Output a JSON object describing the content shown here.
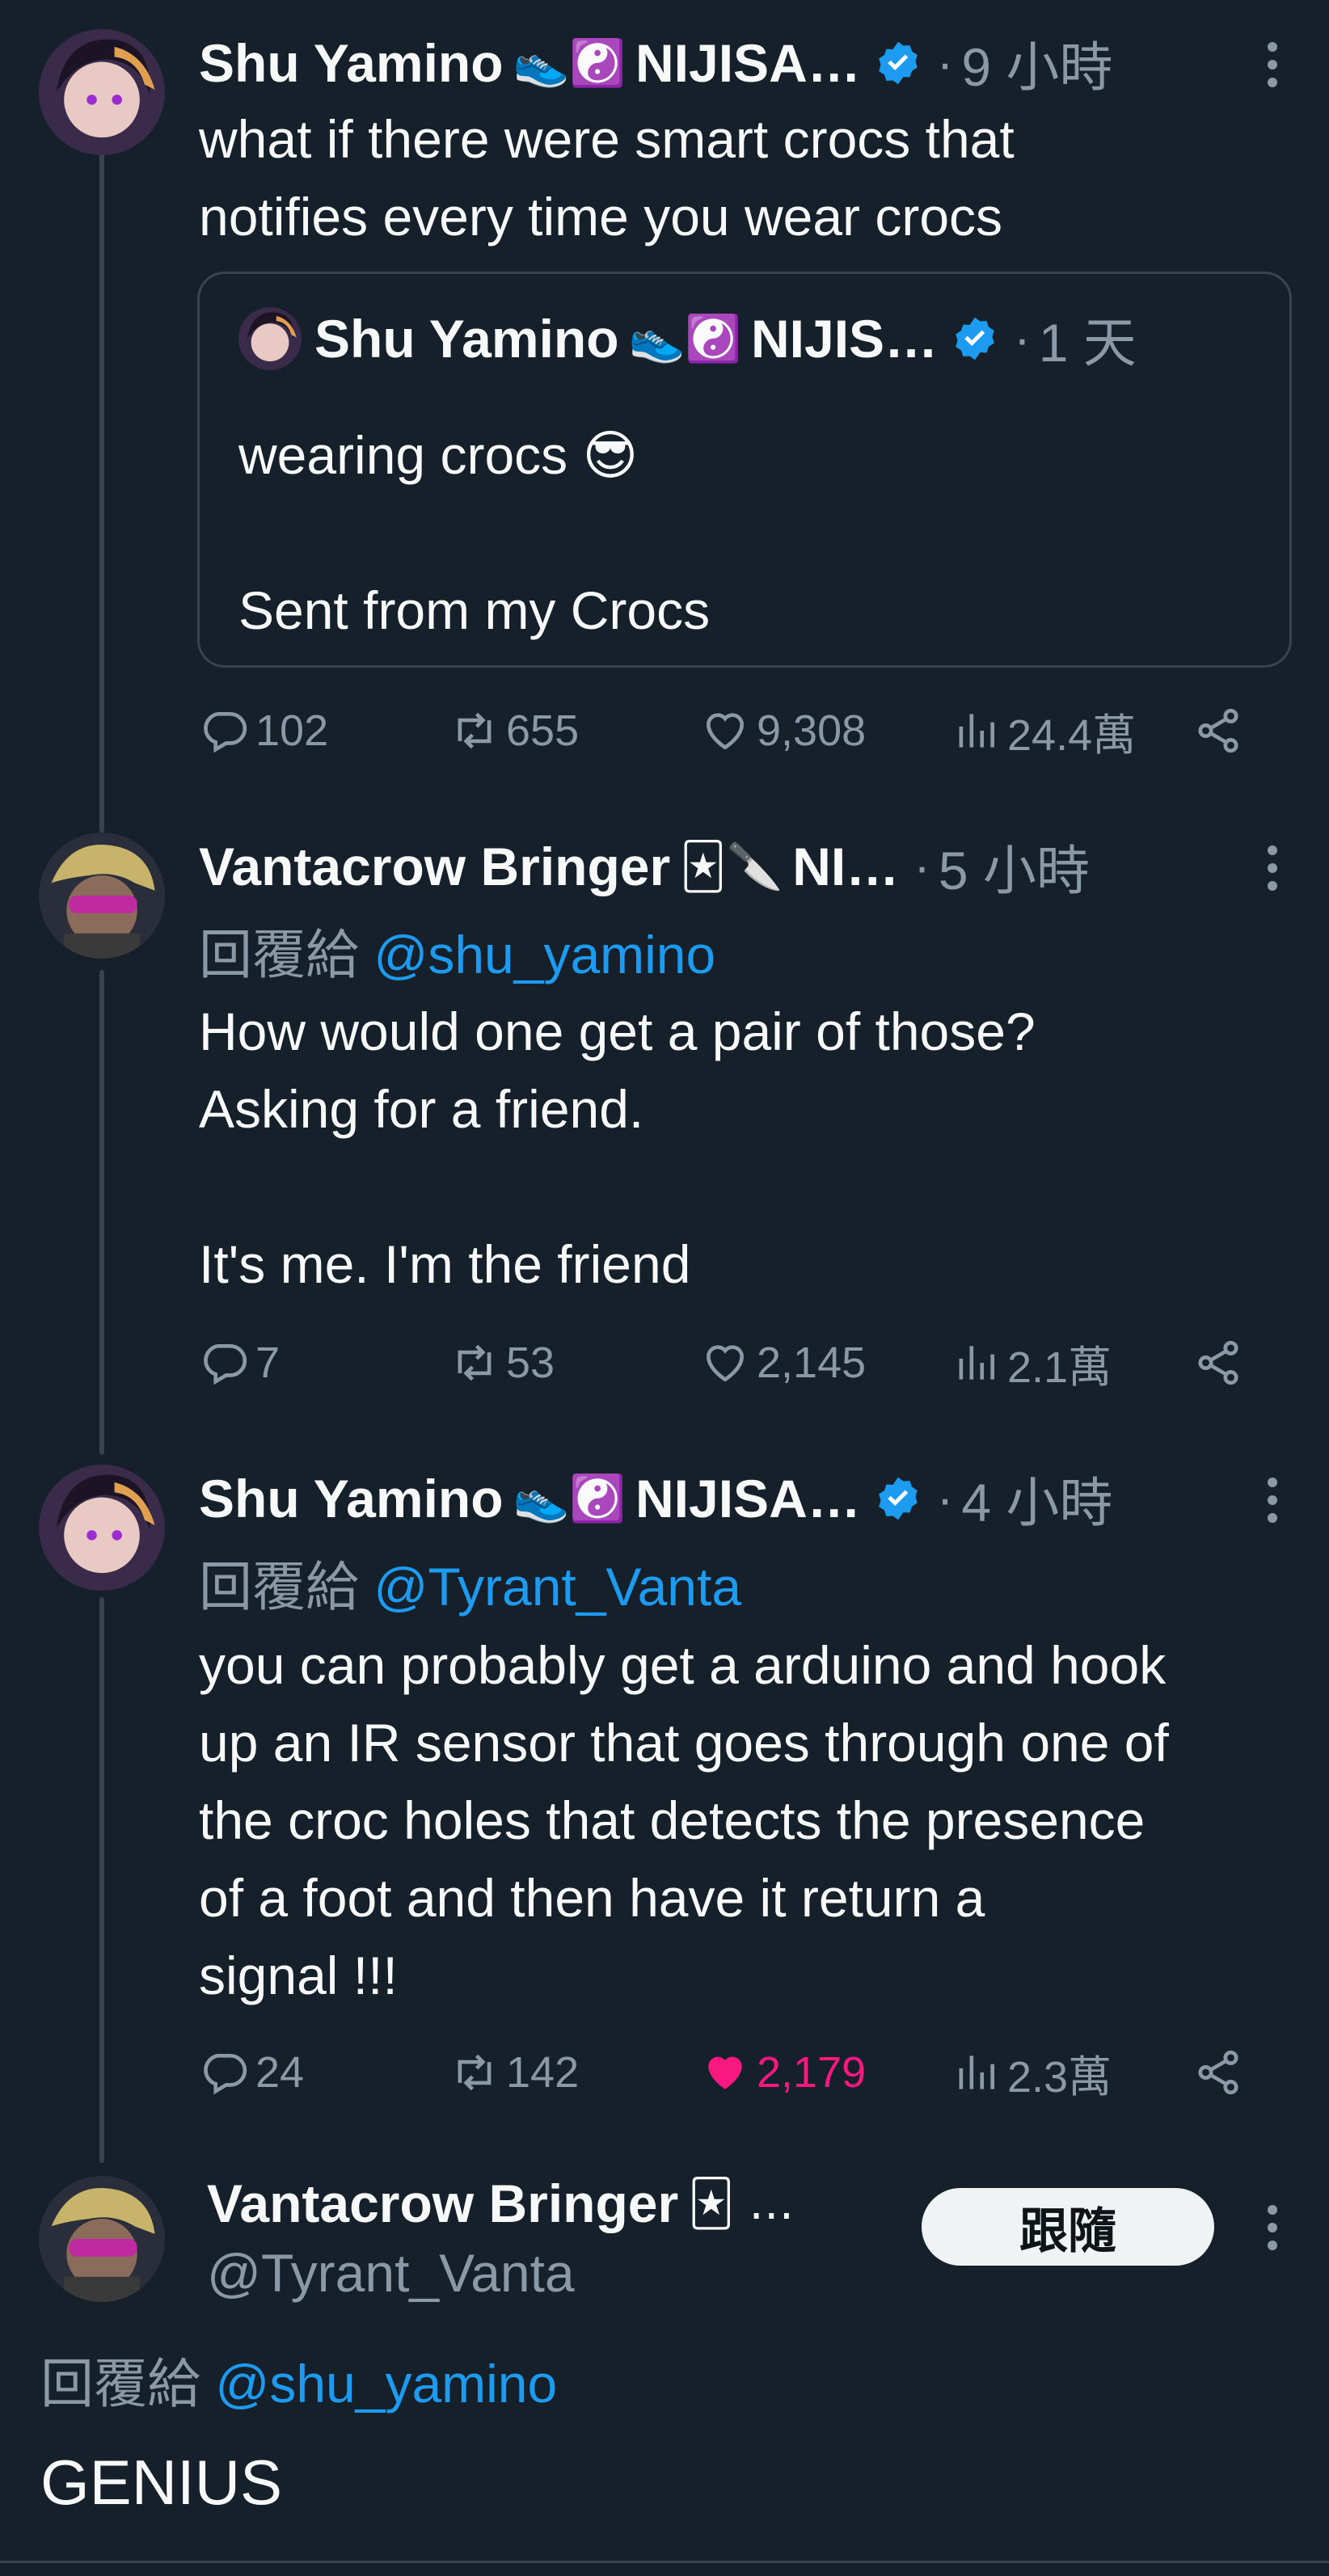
{
  "tweets": [
    {
      "name": "Shu Yamino",
      "emojis": "👟☯️",
      "org": "NIJISA…",
      "verified": true,
      "time": "9 小時",
      "text": "what if there were smart crocs that\nnotifies every time you wear crocs",
      "quote": {
        "name": "Shu Yamino",
        "emojis": "👟☯️",
        "org": "NIJIS…",
        "time": "1 天",
        "text": "wearing crocs 😎\n\nSent from my Crocs"
      },
      "actions": {
        "replies": "102",
        "retweets": "655",
        "likes": "9,308",
        "views": "24.4萬"
      }
    },
    {
      "name": "Vantacrow Bringer",
      "emojis": "🃏🔪",
      "org": "NI…",
      "time": "5 小時",
      "reply_prefix": "回覆給",
      "reply_to": "@shu_yamino",
      "text": "How would one get a pair of those?\nAsking for a friend.\n\nIt's me. I'm the friend",
      "actions": {
        "replies": "7",
        "retweets": "53",
        "likes": "2,145",
        "views": "2.1萬"
      }
    },
    {
      "name": "Shu Yamino",
      "emojis": "👟☯️",
      "org": "NIJISA…",
      "verified": true,
      "time": "4 小時",
      "reply_prefix": "回覆給",
      "reply_to": "@Tyrant_Vanta",
      "text": "you can probably get a arduino and hook\nup an IR sensor that goes through one of\nthe croc holes that detects the presence\nof a foot and then have it return a\nsignal !!!",
      "actions": {
        "replies": "24",
        "retweets": "142",
        "likes": "2,179",
        "views": "2.3萬",
        "liked": true
      }
    }
  ],
  "focused": {
    "name": "Vantacrow Bringer",
    "emojis": "🃏 …",
    "handle": "@Tyrant_Vanta",
    "follow_label": "跟隨",
    "reply_prefix": "回覆給",
    "reply_to": "@shu_yamino",
    "text": "GENIUS"
  },
  "colors": {
    "background": "#15202b",
    "text": "#f7f9f9",
    "secondary": "#8b98a5",
    "link": "#1d9bf0",
    "like": "#f91880",
    "border": "#38444d"
  }
}
